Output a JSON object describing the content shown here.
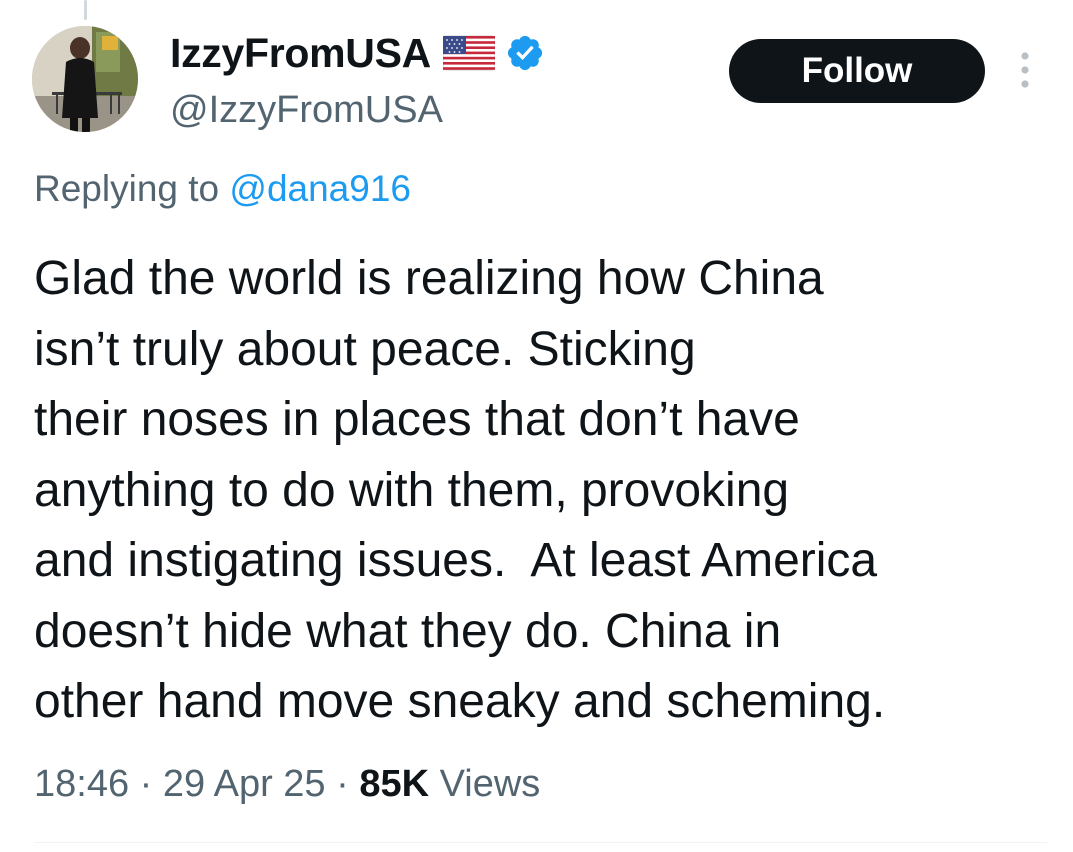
{
  "author": {
    "display_name": "IzzyFromUSA",
    "handle": "@IzzyFromUSA",
    "flag_icon": "us-flag-icon",
    "verified_icon": "verified-badge-icon",
    "verified_color": "#1d9bf0"
  },
  "follow_button": {
    "label": "Follow",
    "background": "#0f1419",
    "text_color": "#ffffff"
  },
  "more_menu": {
    "icon": "more-vertical-icon"
  },
  "reply_context": {
    "prefix": "Replying to",
    "mention": "@dana916",
    "mention_color": "#1d9bf0"
  },
  "tweet": {
    "lines": [
      "Glad the world is realizing how China",
      "isn’t truly about peace. Sticking",
      "their noses in places that don’t have",
      "anything to do with them, provoking",
      "and instigating issues.  At least America",
      "doesn’t hide what they do. China in",
      "other hand move sneaky and scheming."
    ]
  },
  "meta": {
    "time": "18:46",
    "separator": "·",
    "date": "29 Apr 25",
    "views_count": "85K",
    "views_label": "Views"
  }
}
